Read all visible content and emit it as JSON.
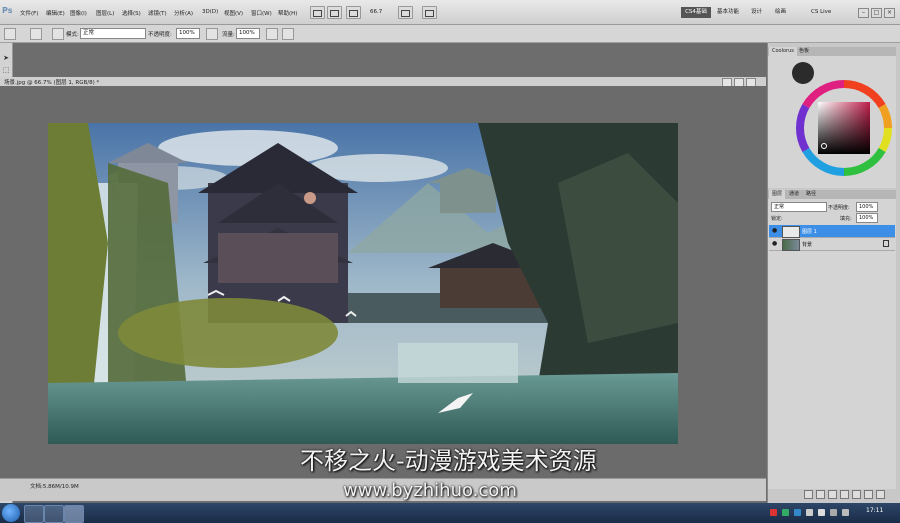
{
  "app": {
    "logo": "Ps",
    "menus": [
      "文件(F)",
      "编辑(E)",
      "图像(I)",
      "图层(L)",
      "选择(S)",
      "滤镜(T)",
      "分析(A)",
      "3D(D)",
      "视图(V)",
      "窗口(W)",
      "帮助(H)"
    ],
    "zoom": "66.7",
    "workspace_active": "CS4基础",
    "workspaces": [
      "基本功能",
      "设计",
      "绘画"
    ],
    "cs_live": "CS Live",
    "window_controls": [
      "–",
      "□",
      "×"
    ]
  },
  "options_bar": {
    "mode_label": "模式:",
    "mode_value": "正常",
    "opacity_label": "不透明度:",
    "opacity_value": "100%",
    "flow_label": "流量:",
    "flow_value": "100%"
  },
  "document": {
    "title": "场景.jpg @ 66.7% (图层 1, RGB/8) *",
    "status": "文档:5.86M/10.9M"
  },
  "color_panel": {
    "tabs": [
      "Coolorus",
      "色板"
    ],
    "accent_colors": {
      "foreground": "#2b2b2b",
      "wheel_red": "#c0204c"
    }
  },
  "layers_panel": {
    "tabs": [
      "图层",
      "通道",
      "路径"
    ],
    "blend_mode": "正常",
    "opacity_label": "不透明度:",
    "opacity_value": "100%",
    "lock_label": "锁定:",
    "fill_label": "填充:",
    "fill_value": "100%",
    "layers": [
      {
        "name": "图层 1",
        "selected": true
      },
      {
        "name": "背景",
        "selected": false
      }
    ],
    "selection_color": "#3d8ee6"
  },
  "watermark": {
    "title": "不移之火-动漫游戏美术资源",
    "url": "www.byzhihuo.com"
  },
  "taskbar": {
    "clock_time": "17:11"
  }
}
